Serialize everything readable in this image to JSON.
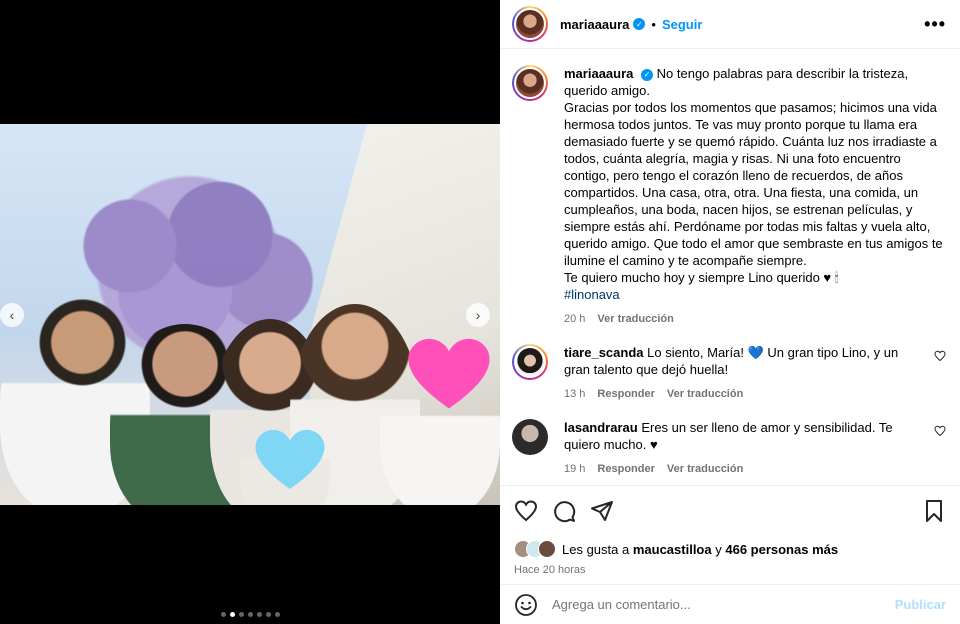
{
  "post": {
    "author": "mariaaaura",
    "follow_label": "Seguir",
    "separator": "•",
    "more_label": "•••"
  },
  "caption": {
    "author": "mariaaaura",
    "text": "No tengo palabras para describir la tristeza, querido amigo.\nGracias por todos los momentos que pasamos; hicimos una vida hermosa todos juntos. Te vas muy pronto porque tu llama era demasiado fuerte y se quemó rápido. Cuánta luz nos irradiaste a todos, cuánta alegría, magia y risas. Ni una foto encuentro contigo, pero tengo el corazón lleno de recuerdos, de años compartidos. Una casa, otra, otra. Una fiesta, una comida, un cumpleaños, una boda, nacen hijos, se estrenan películas, y siempre estás ahí. Perdóname por todas mis faltas y vuela alto, querido amigo. Que todo el amor que sembraste en tus amigos te ilumine el camino y te acompañe siempre.\nTe quiero mucho hoy y siempre Lino querido ♥ 🕯",
    "hashtag": "#linonava",
    "time": "20 h",
    "translate": "Ver traducción"
  },
  "comments": [
    {
      "user": "tiare_scanda",
      "text": "Lo siento, María! 💙  Un gran tipo Lino, y un gran talento que dejó huella!",
      "time": "13 h",
      "reply": "Responder",
      "translate": "Ver traducción"
    },
    {
      "user": "lasandrarau",
      "text": "Eres un ser lleno de amor y sensibilidad. Te quiero mucho. ♥",
      "time": "19 h",
      "reply": "Responder",
      "translate": "Ver traducción"
    }
  ],
  "likes": {
    "prefix": "Les gusta a",
    "user": "maucastilloa",
    "conj": "y",
    "others": "466 personas más",
    "ago": "Hace 20 horas"
  },
  "add_comment": {
    "placeholder": "Agrega un comentario...",
    "publish": "Publicar"
  },
  "carousel": {
    "total": 7,
    "active": 1
  },
  "colors": {
    "link": "#0095f6",
    "hashtag": "#00376b",
    "muted": "#737373",
    "publish_disabled": "#b2dffc"
  }
}
